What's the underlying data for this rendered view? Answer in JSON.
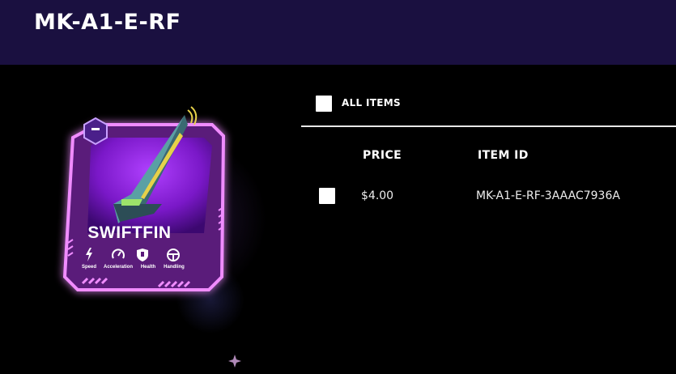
{
  "page": {
    "title": "MK-A1-E-RF"
  },
  "card": {
    "name": "SWIFTFIN",
    "stats": [
      "Speed",
      "Acceleration",
      "Health",
      "Handling"
    ],
    "icons": [
      "lightning-icon",
      "gauge-icon",
      "shield-icon",
      "steering-wheel-icon"
    ],
    "accent": "#e060ff"
  },
  "filter": {
    "all_items_label": "ALL ITEMS",
    "all_items_checked": false
  },
  "table": {
    "columns": [
      "PRICE",
      "ITEM ID"
    ],
    "rows": [
      {
        "checked": false,
        "price": "$4.00",
        "item_id": "MK-A1-E-RF-3AAAC7936A"
      }
    ]
  }
}
